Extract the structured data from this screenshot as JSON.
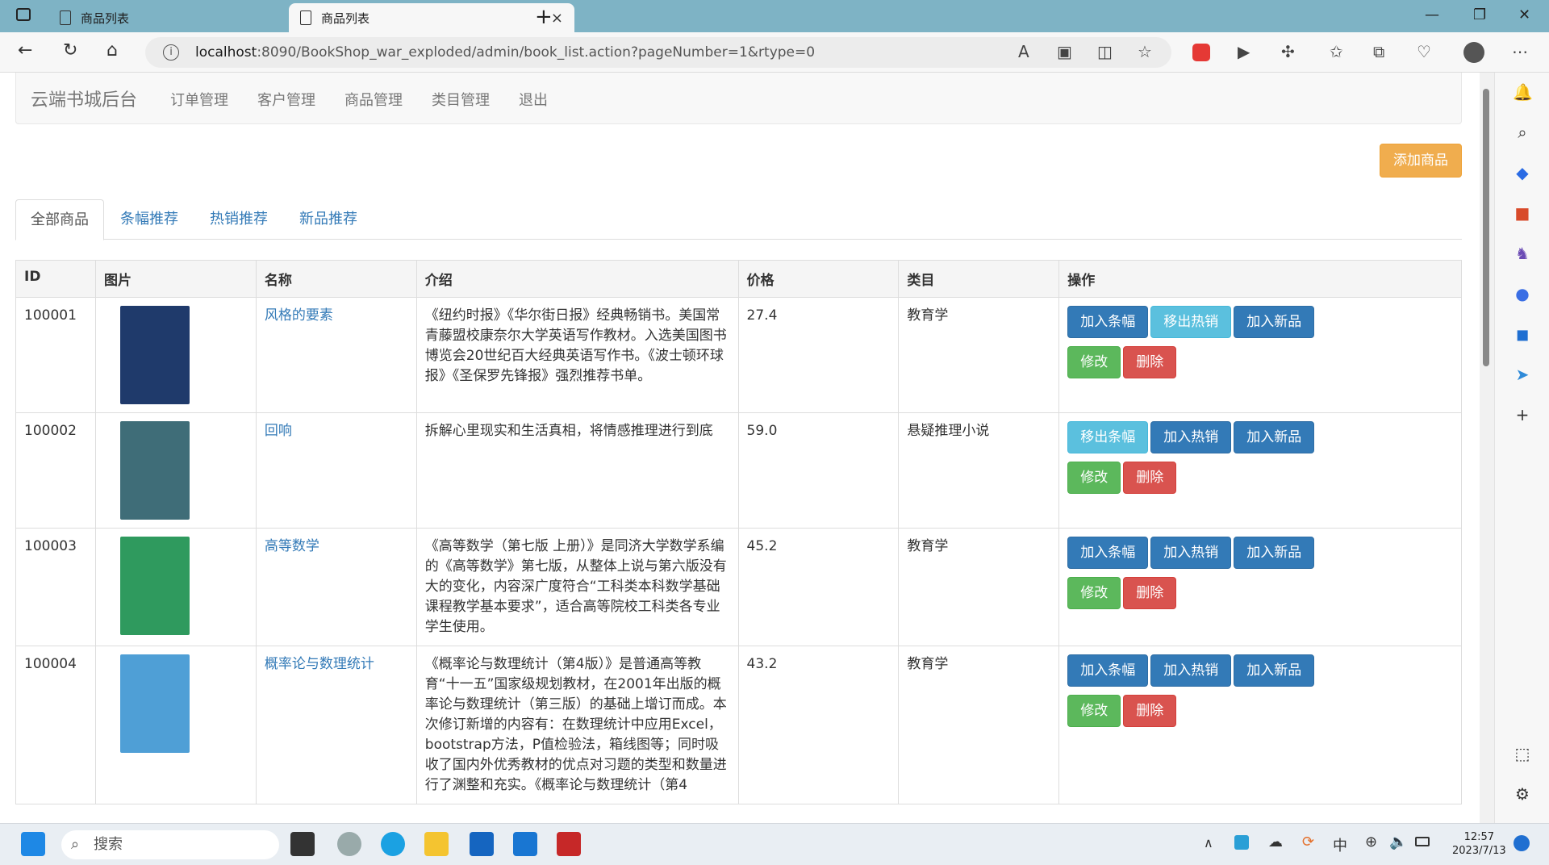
{
  "browser": {
    "tabs": [
      {
        "title": "商品列表",
        "close": "×"
      },
      {
        "title": "商品列表",
        "close": "×"
      }
    ],
    "new_tab": "+",
    "window": {
      "minimize": "—",
      "maximize": "❐",
      "close": "✕"
    },
    "url_host": "localhost",
    "url_rest": ":8090/BookShop_war_exploded/admin/book_list.action?pageNumber=1&rtype=0"
  },
  "site": {
    "brand": "云端书城后台",
    "nav": [
      "订单管理",
      "客户管理",
      "商品管理",
      "类目管理",
      "退出"
    ],
    "add_button": "添加商品",
    "tabs": [
      "全部商品",
      "条幅推荐",
      "热销推荐",
      "新品推荐"
    ],
    "active_tab": 0
  },
  "table": {
    "headers": [
      "ID",
      "图片",
      "名称",
      "介绍",
      "价格",
      "类目",
      "操作"
    ],
    "rows": [
      {
        "id": "100001",
        "name": "风格的要素",
        "intro": "《纽约时报》《华尔街日报》经典畅销书。美国常青藤盟校康奈尔大学英语写作教材。入选美国图书博览会20世纪百大经典英语写作书。《波士顿环球报》《圣保罗先锋报》强烈推荐书单。",
        "price": "27.4",
        "category": "教育学",
        "cover_color": "#1f3a6b",
        "actions": [
          {
            "label": "加入条幅",
            "style": "primary"
          },
          {
            "label": "移出热销",
            "style": "info"
          },
          {
            "label": "加入新品",
            "style": "primary"
          },
          {
            "label": "修改",
            "style": "success"
          },
          {
            "label": "删除",
            "style": "danger"
          }
        ]
      },
      {
        "id": "100002",
        "name": "回响",
        "intro": "拆解心里现实和生活真相，将情感推理进行到底",
        "price": "59.0",
        "category": "悬疑推理小说",
        "cover_color": "#3f6d78",
        "actions": [
          {
            "label": "移出条幅",
            "style": "info"
          },
          {
            "label": "加入热销",
            "style": "primary"
          },
          {
            "label": "加入新品",
            "style": "primary"
          },
          {
            "label": "修改",
            "style": "success"
          },
          {
            "label": "删除",
            "style": "danger"
          }
        ]
      },
      {
        "id": "100003",
        "name": "高等数学",
        "intro": "《高等数学（第七版 上册）》是同济大学数学系编的《高等数学》第七版，从整体上说与第六版没有大的变化，内容深广度符合“工科类本科数学基础课程教学基本要求”，适合高等院校工科类各专业学生使用。",
        "price": "45.2",
        "category": "教育学",
        "cover_color": "#2f9a5e",
        "actions": [
          {
            "label": "加入条幅",
            "style": "primary"
          },
          {
            "label": "加入热销",
            "style": "primary"
          },
          {
            "label": "加入新品",
            "style": "primary"
          },
          {
            "label": "修改",
            "style": "success"
          },
          {
            "label": "删除",
            "style": "danger"
          }
        ]
      },
      {
        "id": "100004",
        "name": "概率论与数理统计",
        "intro": "《概率论与数理统计（第4版）》是普通高等教育“十一五”国家级规划教材，在2001年出版的概率论与数理统计（第三版）的基础上增订而成。本次修订新增的内容有：在数理统计中应用Excel，bootstrap方法，P值检验法，箱线图等；同时吸收了国内外优秀教材的优点对习题的类型和数量进行了渊整和充实。《概率论与数理统计（第4",
        "price": "43.2",
        "category": "教育学",
        "cover_color": "#4f9fd6",
        "actions": [
          {
            "label": "加入条幅",
            "style": "primary"
          },
          {
            "label": "加入热销",
            "style": "primary"
          },
          {
            "label": "加入新品",
            "style": "primary"
          },
          {
            "label": "修改",
            "style": "success"
          },
          {
            "label": "删除",
            "style": "danger"
          }
        ]
      }
    ]
  },
  "taskbar": {
    "search": "搜索",
    "time": "12:57",
    "date": "2023/7/13",
    "ime": "中"
  }
}
